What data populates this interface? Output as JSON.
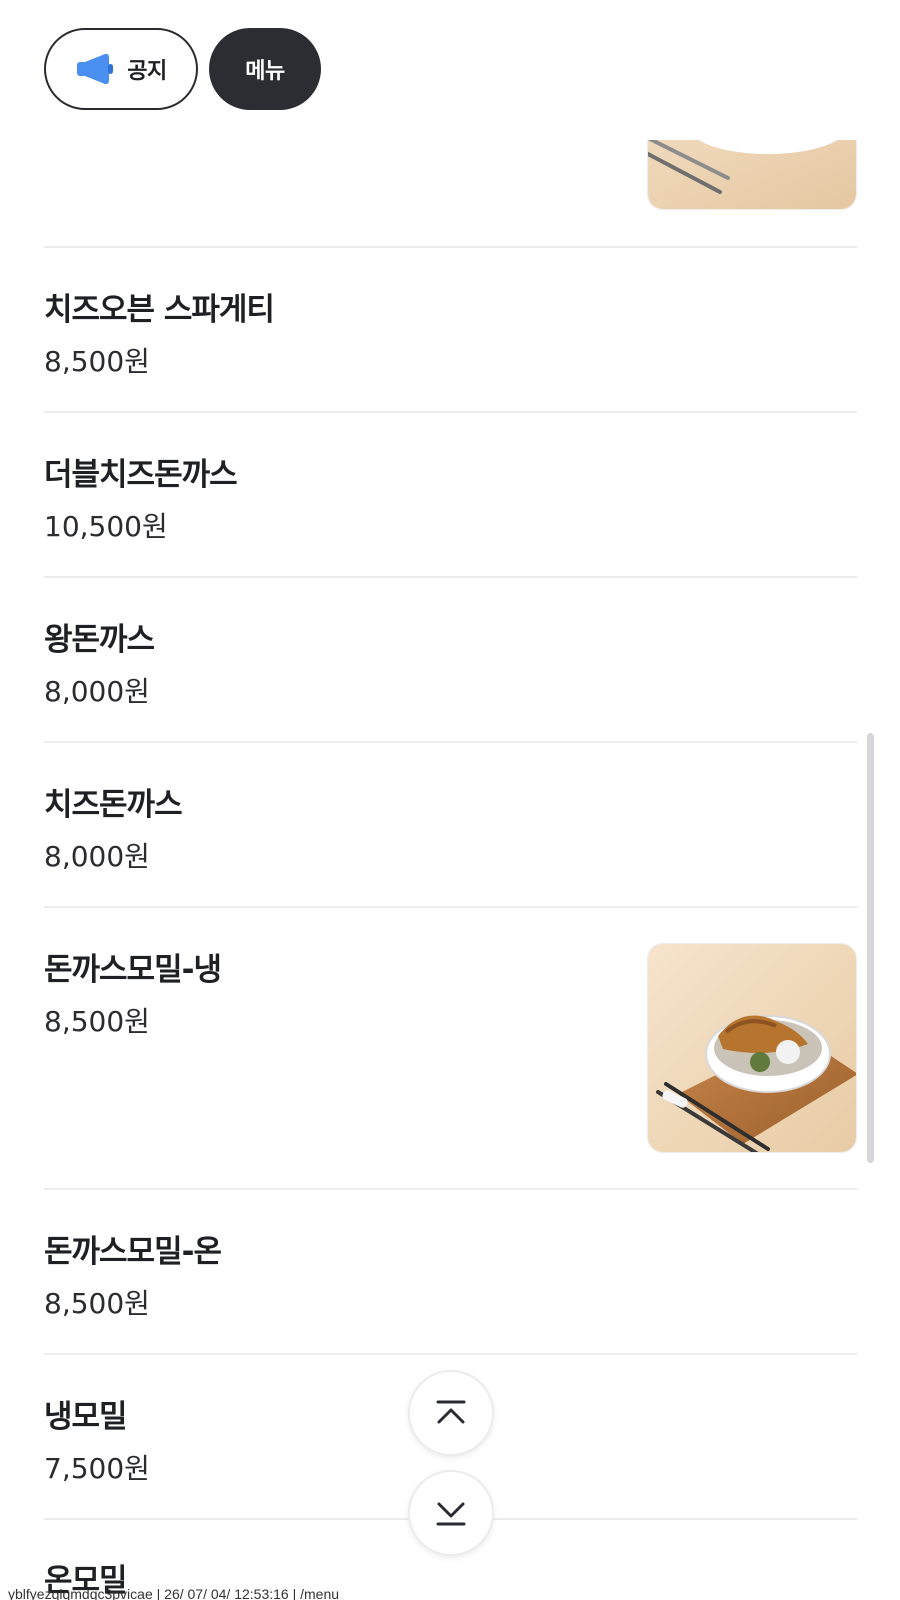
{
  "tabs": {
    "notice_label": "공지",
    "menu_label": "메뉴"
  },
  "menu": {
    "items": [
      {
        "name": "치즈오븐 스파게티",
        "price": "8,500원"
      },
      {
        "name": "더블치즈돈까스",
        "price": "10,500원"
      },
      {
        "name": "왕돈까스",
        "price": "8,000원"
      },
      {
        "name": "치즈돈까스",
        "price": "8,000원"
      },
      {
        "name": "돈까스모밀-냉",
        "price": "8,500원"
      },
      {
        "name": "돈까스모밀-온",
        "price": "8,500원"
      },
      {
        "name": "냉모밀",
        "price": "7,500원"
      },
      {
        "name": "온모밀",
        "price": ""
      }
    ]
  },
  "icons": {
    "notice": "megaphone-icon",
    "scroll_top": "chevron-up-to-top-icon",
    "scroll_bottom": "chevron-down-to-bottom-icon"
  },
  "colors": {
    "active_chip": "#2c2d33",
    "megaphone": "#4a8ef0",
    "divider": "#ececef"
  },
  "footer": {
    "text": "yblfyezqlqmdqc3pvicae | 26/ 07/ 04/ 12:53:16 | /menu"
  }
}
